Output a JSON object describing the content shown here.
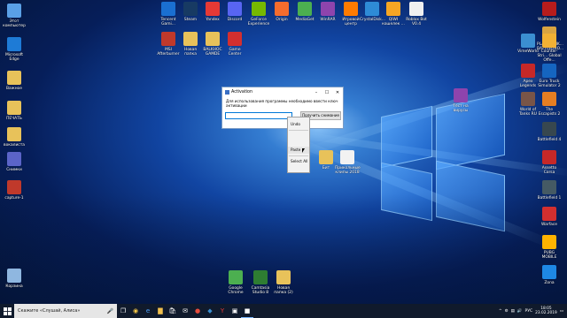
{
  "desktop_icons": [
    {
      "label": "Этот компьютер",
      "color": "#5aa0e6",
      "pos": "l1"
    },
    {
      "label": "Microsoft Edge",
      "color": "#1e7bd6",
      "pos": "l2"
    },
    {
      "label": "Важное",
      "color": "#e8c25a",
      "pos": "l3"
    },
    {
      "label": "ПЕЧАТЬ",
      "color": "#e8c25a",
      "pos": "l4"
    },
    {
      "label": "вокалиста",
      "color": "#e8c25a",
      "pos": "l5"
    },
    {
      "label": "Снимки",
      "color": "#5b64c8",
      "pos": "l6"
    },
    {
      "label": "capture-1",
      "color": "#c0392b",
      "pos": "l7"
    },
    {
      "label": "Корзина",
      "color": "#8fb7e0",
      "pos": "l8"
    },
    {
      "label": "Tencent Gami...",
      "color": "#1a6fd1",
      "pos": "t1"
    },
    {
      "label": "Steam",
      "color": "#173a63",
      "pos": "t2"
    },
    {
      "label": "Yandex",
      "color": "#e53935",
      "pos": "t3"
    },
    {
      "label": "Discord",
      "color": "#5865f2",
      "pos": "t4"
    },
    {
      "label": "GeForce Experience",
      "color": "#76b900",
      "pos": "t5"
    },
    {
      "label": "Origin",
      "color": "#f56c2d",
      "pos": "t6"
    },
    {
      "label": "MediaGet",
      "color": "#4caf50",
      "pos": "t7"
    },
    {
      "label": "WinRAR",
      "color": "#8e44ad",
      "pos": "t8"
    },
    {
      "label": "Игровой центр",
      "color": "#ff7b00",
      "pos": "t9"
    },
    {
      "label": "CrystalDisk...",
      "color": "#2e8bd6",
      "pos": "t10"
    },
    {
      "label": "QIWI кошелек ...",
      "color": "#f6a623",
      "pos": "t11"
    },
    {
      "label": "Roblox Bot V0.4",
      "color": "#f0f0f0",
      "pos": "t12"
    },
    {
      "label": "MSI Afterburner",
      "color": "#c0392b",
      "pos": "t13"
    },
    {
      "label": "Новая папка",
      "color": "#e8c25a",
      "pos": "t14"
    },
    {
      "label": "BALKHOC GAMDE",
      "color": "#e8c25a",
      "pos": "t15"
    },
    {
      "label": "Game Center",
      "color": "#d32f2f",
      "pos": "t16"
    },
    {
      "label": "Wolfenstein",
      "color": "#b71c1c",
      "pos": "r1"
    },
    {
      "label": "PLAYERUNK... BATTLEGRO...",
      "color": "#d9a441",
      "pos": "r2"
    },
    {
      "label": "VimeWorld",
      "color": "#3b8fd1",
      "pos": "r3"
    },
    {
      "label": "Counter-Stri... Global Offe...",
      "color": "#f2b134",
      "pos": "r4"
    },
    {
      "label": "Apex Legends",
      "color": "#c62828",
      "pos": "r5"
    },
    {
      "label": "Euro Truck Simulator 2",
      "color": "#1565c0",
      "pos": "r6"
    },
    {
      "label": "World of Tanks RU",
      "color": "#795548",
      "pos": "r7"
    },
    {
      "label": "The Escapists 2",
      "color": "#e67e22",
      "pos": "r8"
    },
    {
      "label": "Battlefield 4",
      "color": "#37474f",
      "pos": "r9"
    },
    {
      "label": "Assetto Corsa",
      "color": "#c62828",
      "pos": "r10"
    },
    {
      "label": "Battlefield 1",
      "color": "#455a64",
      "pos": "r11"
    },
    {
      "label": "Warface",
      "color": "#d32f2f",
      "pos": "r12"
    },
    {
      "label": "PUBG MOBILE",
      "color": "#ffb300",
      "pos": "r13"
    },
    {
      "label": "Zona",
      "color": "#1e88e5",
      "pos": "r14"
    },
    {
      "label": "Google Chrome",
      "color": "#4caf50",
      "pos": "b1"
    },
    {
      "label": "Camtasia Studio 8",
      "color": "#2e7d32",
      "pos": "b2"
    },
    {
      "label": "Новая папка (2)",
      "color": "#e8c25a",
      "pos": "b3"
    },
    {
      "label": "Бит",
      "color": "#e8c25a",
      "pos": "m1"
    },
    {
      "label": "Прикольные клипы 2018",
      "color": "#f2f2f2",
      "pos": "m2"
    },
    {
      "label": "Тест на вирусы",
      "color": "#8e44ad",
      "pos": "m3"
    }
  ],
  "dialog": {
    "title": "Activation",
    "message": "Для использования программы необходимо ввести ключ активации",
    "input_value": "",
    "button_label": "Получить снимание",
    "min": "–",
    "max": "☐",
    "close": "✕"
  },
  "context_menu": {
    "items": [
      "Undo",
      "Paste",
      "Select All"
    ]
  },
  "taskbar": {
    "search_placeholder": "Скажите «Слушай, Алиса»",
    "lang": "РУС",
    "time": "18:05",
    "date": "23.02.2019"
  }
}
